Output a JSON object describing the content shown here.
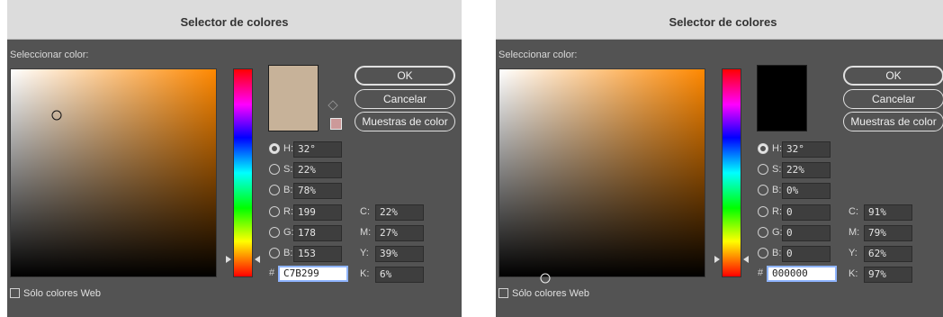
{
  "dialogs": [
    {
      "title": "Selector de colores",
      "select_label": "Seleccionar color:",
      "swatch_color": "#C7B299",
      "websafe_swatch_color": "#cc9999",
      "ok_label": "OK",
      "cancel_label": "Cancelar",
      "library_label": "Muestras de color",
      "h_label": "H:",
      "h_value": "32°",
      "s_label": "S:",
      "s_value": "22%",
      "b_label": "B:",
      "b_value": "78%",
      "r_label": "R:",
      "r_value": "199",
      "g_label": "G:",
      "g_value": "178",
      "bl_label": "B:",
      "bl_value": "153",
      "hash": "#",
      "hex_value": "C7B299",
      "c_label": "C:",
      "c_value": "22%",
      "m_label": "M:",
      "m_value": "27%",
      "y_label": "Y:",
      "y_value": "39%",
      "k_label": "K:",
      "k_value": "6%",
      "websafe_label": "Sólo colores Web",
      "hue_fraction": 0.91,
      "marker_saturation": 0.22,
      "marker_brightness": 0.78
    },
    {
      "title": "Selector de colores",
      "select_label": "Seleccionar color:",
      "swatch_color": "#000000",
      "ok_label": "OK",
      "cancel_label": "Cancelar",
      "library_label": "Muestras de color",
      "h_label": "H:",
      "h_value": "32°",
      "s_label": "S:",
      "s_value": "22%",
      "b_label": "B:",
      "b_value": "0%",
      "r_label": "R:",
      "r_value": "0",
      "g_label": "G:",
      "g_value": "0",
      "bl_label": "B:",
      "bl_value": "0",
      "hash": "#",
      "hex_value": "000000",
      "c_label": "C:",
      "c_value": "91%",
      "m_label": "M:",
      "m_value": "79%",
      "y_label": "Y:",
      "y_value": "62%",
      "k_label": "K:",
      "k_value": "97%",
      "websafe_label": "Sólo colores Web",
      "hue_fraction": 0.91,
      "marker_saturation": 0.22,
      "marker_brightness": 0.0
    }
  ],
  "icons": {
    "cube": "cube-icon",
    "radio": "radio-icon",
    "checkbox": "checkbox-icon"
  }
}
